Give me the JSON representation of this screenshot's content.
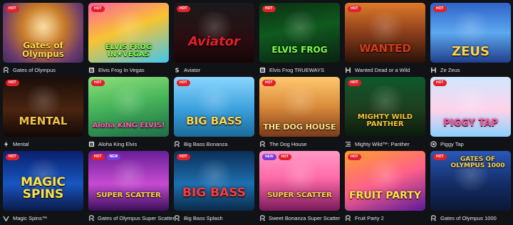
{
  "games": [
    {
      "name": "Gates of Olympus",
      "thumb_title": "Gates of Olympus",
      "badges": [
        "HOT"
      ],
      "provider_icon": "pragmatic-play-icon",
      "title_color": "#ffd34d",
      "bg": "bg0"
    },
    {
      "name": "Elvis Frog In Vegas",
      "thumb_title": "ELVIS FROG IN★VEGAS",
      "badges": [
        "HOT"
      ],
      "provider_icon": "bgaming-icon",
      "title_color": "#7dff4a",
      "bg": "bg1"
    },
    {
      "name": "Aviator",
      "thumb_title": "Aviator",
      "badges": [
        "HOT"
      ],
      "provider_icon": "spribe-icon",
      "title_color": "#e0202a",
      "bg": "bg2"
    },
    {
      "name": "Elvis Frog TRUEWAYS",
      "thumb_title": "ELVIS FROG",
      "badges": [
        "HOT"
      ],
      "provider_icon": "bgaming-icon",
      "title_color": "#7dff4a",
      "bg": "bg3"
    },
    {
      "name": "Wanted Dead or a Wild",
      "thumb_title": "WANTED",
      "badges": [
        "HOT"
      ],
      "provider_icon": "hacksaw-icon",
      "title_color": "#d23a1c",
      "bg": "bg4"
    },
    {
      "name": "Ze Zeus",
      "thumb_title": "ZEUS",
      "badges": [
        "HOT"
      ],
      "provider_icon": "hacksaw-icon",
      "title_color": "#ffd34d",
      "bg": "bg5"
    },
    {
      "name": "Mental",
      "thumb_title": "MENTAL",
      "badges": [
        "HOT"
      ],
      "provider_icon": "nolimit-city-icon",
      "title_color": "#f3c14a",
      "bg": "bg6"
    },
    {
      "name": "Aloha King Elvis",
      "thumb_title": "Aloha KING ELVIS!",
      "badges": [
        "HOT"
      ],
      "provider_icon": "bgaming-icon",
      "title_color": "#ff5ab0",
      "bg": "bg7"
    },
    {
      "name": "Big Bass Bonanza",
      "thumb_title": "BIG BASS",
      "badges": [
        "HOT"
      ],
      "provider_icon": "pragmatic-play-icon",
      "title_color": "#ffd34d",
      "bg": "bg8"
    },
    {
      "name": "The Dog House",
      "thumb_title": "THE DOG HOUSE",
      "badges": [
        "HOT"
      ],
      "provider_icon": "pragmatic-play-icon",
      "title_color": "#ffe08a",
      "bg": "bg9"
    },
    {
      "name": "Mighty Wild™: Panther",
      "thumb_title": "MIGHTY WILD PANTHER",
      "badges": [
        "HOT"
      ],
      "provider_icon": "gameart-icon",
      "title_color": "#f7c431",
      "bg": "bg10"
    },
    {
      "name": "Piggy Tap",
      "thumb_title": "PIGGY TAP",
      "badges": [
        "HOT"
      ],
      "provider_icon": "piggy-tap-provider-icon",
      "title_color": "#ff4fa0",
      "bg": "bg11"
    },
    {
      "name": "Magic Spins™",
      "thumb_title": "MAGIC SPINS",
      "badges": [
        "HOT"
      ],
      "provider_icon": "vibra-icon",
      "title_color": "#ffe14a",
      "bg": "bg12"
    },
    {
      "name": "Gates of Olympus Super Scatter",
      "thumb_title": "SUPER SCATTER",
      "badges": [
        "HOT",
        "NEW"
      ],
      "provider_icon": "pragmatic-play-icon",
      "title_color": "#ffd34d",
      "bg": "bg13"
    },
    {
      "name": "Big Bass Splash",
      "thumb_title": "BIG BASS",
      "badges": [
        "HOT"
      ],
      "provider_icon": "pragmatic-play-icon",
      "title_color": "#ff3a3a",
      "bg": "bg14"
    },
    {
      "name": "Sweet Bonanza Super Scatter",
      "thumb_title": "SUPER SCATTER",
      "badges": [
        "NEW",
        "HOT"
      ],
      "provider_icon": "pragmatic-play-icon",
      "title_color": "#ffd34d",
      "bg": "bg15"
    },
    {
      "name": "Fruit Party 2",
      "thumb_title": "FRUIT PARTY",
      "badges": [
        "HOT"
      ],
      "provider_icon": "pragmatic-play-icon",
      "title_color": "#ffe14a",
      "bg": "bg16"
    },
    {
      "name": "Gates of Olympus 1000",
      "thumb_title": "GATES OF OLYMPUS 1000",
      "badges": [
        "HOT"
      ],
      "provider_icon": "pragmatic-play-icon",
      "title_color": "#ffd34d",
      "bg": "bg17"
    }
  ],
  "colors": {
    "page_bg": "#101216",
    "hot": "#e0202a",
    "new": "#7a3bd8",
    "caption_text": "#e8e8ea"
  }
}
